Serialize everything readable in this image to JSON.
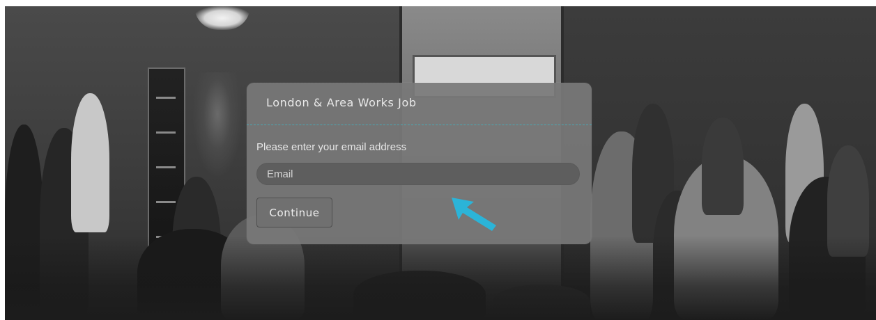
{
  "modal": {
    "title": "London & Area Works Job",
    "prompt_label": "Please enter your email address",
    "email_input": {
      "value": "",
      "placeholder": "Email"
    },
    "continue_label": "Continue",
    "divider_color": "#4aa8b4"
  },
  "pointer": {
    "icon": "arrow-pointer-icon",
    "color": "#2bb4d8"
  },
  "background": {
    "description_icon": "event-crowd-photo"
  }
}
